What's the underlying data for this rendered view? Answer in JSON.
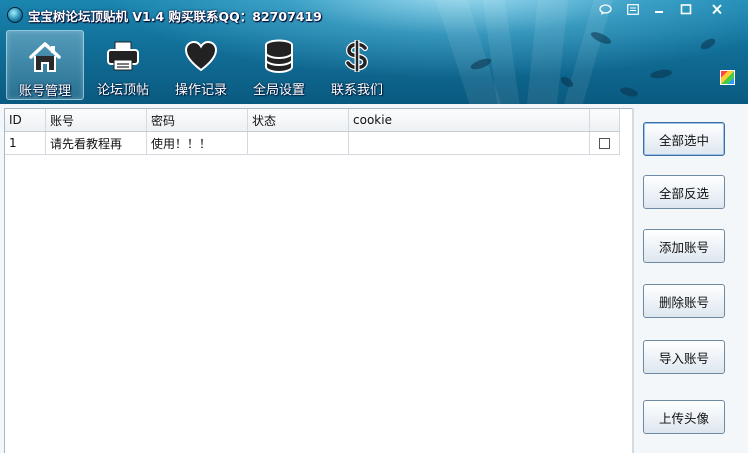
{
  "window": {
    "title": "宝宝树论坛顶贴机 V1.4 购买联系QQ：82707419"
  },
  "title_buttons": [
    {
      "name": "feedback-icon"
    },
    {
      "name": "menu-icon"
    },
    {
      "name": "minimize-icon"
    },
    {
      "name": "maximize-icon"
    },
    {
      "name": "close-icon"
    }
  ],
  "toolbar": {
    "items": [
      {
        "label": "账号管理",
        "icon": "home-icon",
        "active": true
      },
      {
        "label": "论坛顶帖",
        "icon": "printer-icon",
        "active": false
      },
      {
        "label": "操作记录",
        "icon": "heart-icon",
        "active": false
      },
      {
        "label": "全局设置",
        "icon": "database-icon",
        "active": false
      },
      {
        "label": "联系我们",
        "icon": "dollar-icon",
        "active": false
      }
    ]
  },
  "grid": {
    "columns": [
      "ID",
      "账号",
      "密码",
      "状态",
      "cookie",
      ""
    ],
    "rows": [
      {
        "id": "1",
        "account": "请先看教程再",
        "password": "使用！！！",
        "status": "",
        "cookie": "",
        "checked": false
      }
    ]
  },
  "side_buttons": [
    {
      "label": "全部选中"
    },
    {
      "label": "全部反选"
    },
    {
      "label": "添加账号"
    },
    {
      "label": "删除账号"
    },
    {
      "label": "导入账号"
    },
    {
      "label": "上传头像"
    }
  ],
  "colors": {
    "header_top": "#1a86b0",
    "header_bottom": "#0a5a80",
    "body_bg": "#f4f7fa",
    "button_border": "#6f8aa3"
  }
}
